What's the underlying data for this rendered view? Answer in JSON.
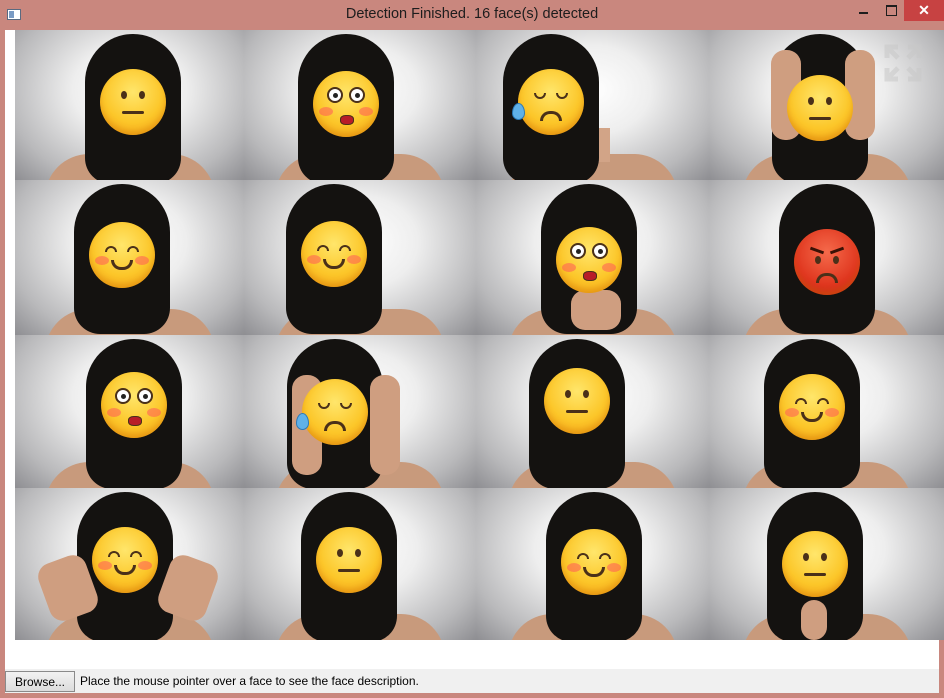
{
  "window": {
    "title": "Detection Finished. 16 face(s) detected",
    "close_glyph": "✕"
  },
  "faces": [
    {
      "emoji": "neutral"
    },
    {
      "emoji": "flushed"
    },
    {
      "emoji": "sad-tear"
    },
    {
      "emoji": "neutral"
    },
    {
      "emoji": "smiling"
    },
    {
      "emoji": "smiling"
    },
    {
      "emoji": "flushed"
    },
    {
      "emoji": "angry"
    },
    {
      "emoji": "flushed"
    },
    {
      "emoji": "sad-tear"
    },
    {
      "emoji": "neutral"
    },
    {
      "emoji": "smiling"
    },
    {
      "emoji": "smiling"
    },
    {
      "emoji": "neutral"
    },
    {
      "emoji": "smiling"
    },
    {
      "emoji": "neutral"
    }
  ],
  "statusbar": {
    "browse_label": "Browse...",
    "message": "Place the mouse pointer over a face to see the face description."
  },
  "colors": {
    "window_frame": "#c9877e",
    "close_button": "#c74242",
    "statusbar_bg": "#f0f0f0"
  }
}
